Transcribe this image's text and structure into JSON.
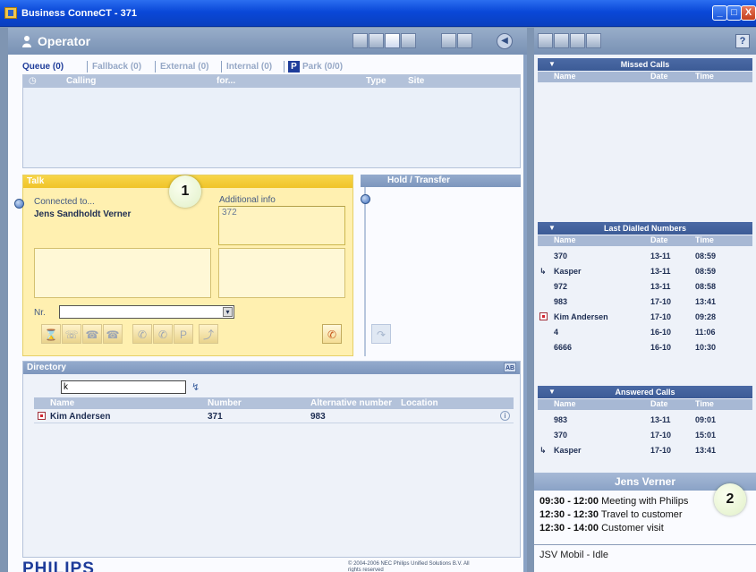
{
  "window": {
    "title": "Business ConneCT - 371",
    "minimize": "_",
    "maximize": "□",
    "close": "X"
  },
  "operator": {
    "title": "Operator",
    "back_glyph": "◀",
    "tabs": [
      {
        "label": "Queue",
        "count": "(0)"
      },
      {
        "label": "Fallback",
        "count": "(0)"
      },
      {
        "label": "External",
        "count": "(0)"
      },
      {
        "label": "Internal",
        "count": "(0)"
      },
      {
        "label": "Park",
        "count": "(0/0)",
        "badge": "P"
      }
    ],
    "queue_columns": {
      "clock": "◷",
      "calling": "Calling",
      "for": "for...",
      "type": "Type",
      "site": "Site"
    }
  },
  "talk": {
    "title": "Talk",
    "connected_label": "Connected to...",
    "caller": "Jens Sandholdt Verner",
    "additional_label": "Additional info",
    "additional_value": "372",
    "nr_label": "Nr.",
    "nr_value": "",
    "dropdown_arrow": "▾",
    "marker": "1",
    "buttons": [
      {
        "name": "hourglass-icon",
        "glyph": "⌛"
      },
      {
        "name": "keypad-phone-icon",
        "glyph": "☏"
      },
      {
        "name": "phone-transfer-icon",
        "glyph": "☎"
      },
      {
        "name": "phone-hangup-icon",
        "glyph": "☎"
      },
      {
        "name": "handset-icon",
        "glyph": "✆"
      },
      {
        "name": "handset-forward-icon",
        "glyph": "✆"
      },
      {
        "name": "park-icon",
        "glyph": "P"
      },
      {
        "name": "pickup-icon",
        "glyph": "⤴"
      },
      {
        "name": "answer-call-icon",
        "glyph": "✆"
      }
    ]
  },
  "hold": {
    "title": "Hold / Transfer",
    "transfer_glyph": "↷"
  },
  "directory": {
    "title": "Directory",
    "ab_label": "AB",
    "search_value": "k",
    "clear_glyph": "↯",
    "columns": {
      "name": "Name",
      "number": "Number",
      "alternative": "Alternative number",
      "location": "Location"
    },
    "rows": [
      {
        "name": "Kim Andersen",
        "number": "371",
        "alternative": "983",
        "info": "i"
      }
    ]
  },
  "footer": {
    "logo": "PHILIPS",
    "copyright": "© 2004-2006 NEC Philips Unified Solutions B.V. All rights reserved"
  },
  "right": {
    "help": "?",
    "missed": {
      "title": "Missed Calls",
      "cols": {
        "name": "Name",
        "date": "Date",
        "time": "Time"
      },
      "rows": []
    },
    "dialled": {
      "title": "Last Dialled Numbers",
      "cols": {
        "name": "Name",
        "date": "Date",
        "time": "Time"
      },
      "rows": [
        {
          "name": "370",
          "date": "13-11",
          "time": "08:59"
        },
        {
          "name": "Kasper",
          "date": "13-11",
          "time": "08:59",
          "icon": "forward"
        },
        {
          "name": "972",
          "date": "13-11",
          "time": "08:58"
        },
        {
          "name": "983",
          "date": "17-10",
          "time": "13:41"
        },
        {
          "name": "Kim Andersen",
          "date": "17-10",
          "time": "09:28",
          "icon": "contact"
        },
        {
          "name": "4",
          "date": "16-10",
          "time": "11:06"
        },
        {
          "name": "6666",
          "date": "16-10",
          "time": "10:30"
        }
      ]
    },
    "answered": {
      "title": "Answered Calls",
      "cols": {
        "name": "Name",
        "date": "Date",
        "time": "Time"
      },
      "rows": [
        {
          "name": "983",
          "date": "13-11",
          "time": "09:01"
        },
        {
          "name": "370",
          "date": "17-10",
          "time": "15:01"
        },
        {
          "name": "Kasper",
          "date": "17-10",
          "time": "13:41",
          "icon": "forward"
        }
      ]
    },
    "profile": {
      "name": "Jens Verner",
      "marker": "2",
      "appointments": [
        {
          "time": "09:30 - 12:00",
          "text": "Meeting with Philips"
        },
        {
          "time": "12:30 - 12:30",
          "text": "Travel to customer"
        },
        {
          "time": "12:30 - 14:00",
          "text": "Customer visit"
        }
      ],
      "status": "JSV Mobil - Idle"
    }
  },
  "colors": {
    "accent": "#1e3c9a",
    "talk_bg": "#fff0b0",
    "talk_header": "#f0c428",
    "section_header": "#3c5b96"
  }
}
